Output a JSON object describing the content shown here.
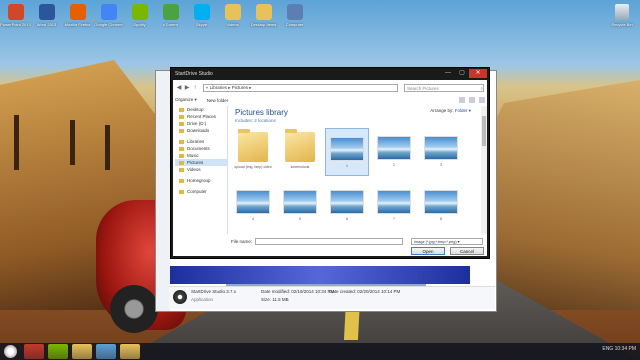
{
  "desktop": {
    "icons": [
      {
        "label": "PowerPoint 2013",
        "color": "#d24726"
      },
      {
        "label": "Word 2013",
        "color": "#2b579a"
      },
      {
        "label": "Mozilla Firefox",
        "color": "#e66000"
      },
      {
        "label": "Google Chrome",
        "color": "#4285f4"
      },
      {
        "label": "Spotify",
        "color": "#7ab800"
      },
      {
        "label": "uTorrent",
        "color": "#4aa340"
      },
      {
        "label": "Skype",
        "color": "#00aff0"
      },
      {
        "label": "Videos",
        "color": "#e8c15a"
      },
      {
        "label": "Desktop Items",
        "color": "#e8c15a"
      },
      {
        "label": "Computer",
        "color": "#5a7fb0"
      }
    ],
    "recycle_bin": "Recycle Bin"
  },
  "dialog": {
    "title": "StartDrive Studio",
    "close_symbol": "✕",
    "minimize_symbol": "—",
    "maximize_symbol": "▢",
    "address_path": "« Libraries ▸ Pictures ▸",
    "search_placeholder": "Search Pictures",
    "organize": "Organize ▾",
    "new_folder": "New folder",
    "nav_items": [
      {
        "label": "Desktop",
        "selected": false
      },
      {
        "label": "Recent Places",
        "selected": false
      },
      {
        "label": "Drive (D:)",
        "selected": false
      },
      {
        "label": "Downloads",
        "selected": false
      },
      {
        "label": "Libraries",
        "selected": false
      },
      {
        "label": "Documents",
        "selected": false
      },
      {
        "label": "Music",
        "selected": false
      },
      {
        "label": "Pictures",
        "selected": true
      },
      {
        "label": "Videos",
        "selected": false
      },
      {
        "label": "Homegroup",
        "selected": false
      },
      {
        "label": "Computer",
        "selected": false
      }
    ],
    "library_title": "Pictures library",
    "library_subtitle": "Includes: 2 locations",
    "arrange_label": "Arrange by:",
    "arrange_value": "Folder ▾",
    "files": [
      {
        "type": "folder",
        "caption": "upload (img, bmp) video"
      },
      {
        "type": "folder",
        "caption": "screenshots"
      },
      {
        "type": "photo",
        "caption": "1",
        "selected": true
      },
      {
        "type": "photo",
        "caption": "2"
      },
      {
        "type": "photo",
        "caption": "3"
      },
      {
        "type": "photo",
        "caption": "4"
      },
      {
        "type": "photo",
        "caption": "5"
      },
      {
        "type": "photo",
        "caption": "6"
      },
      {
        "type": "photo",
        "caption": "7"
      },
      {
        "type": "photo",
        "caption": "8"
      }
    ],
    "filename_label": "File name:",
    "filename_value": "",
    "filetype_value": "Image (*.jpg;*.bmp;*.png) ▾",
    "open_label": "Open",
    "cancel_label": "Cancel"
  },
  "details": {
    "app_name": "StartDrive Studio 3.7.x",
    "app_type": "Application",
    "date_modified_label": "Date modified: 02/19/2014 10:34 PM",
    "size_label": "Size: 11.5 MB",
    "date_created_label": "Date created: 02/20/2014 10:14 PM"
  },
  "taskbar": {
    "items": [
      {
        "color": "#c23a2d"
      },
      {
        "color": "#7ab800"
      },
      {
        "color": "#e8c15a"
      },
      {
        "color": "#5aa0d8"
      },
      {
        "color": "#e8c15a"
      }
    ],
    "tray_text": "ENG 10:34 PM"
  }
}
